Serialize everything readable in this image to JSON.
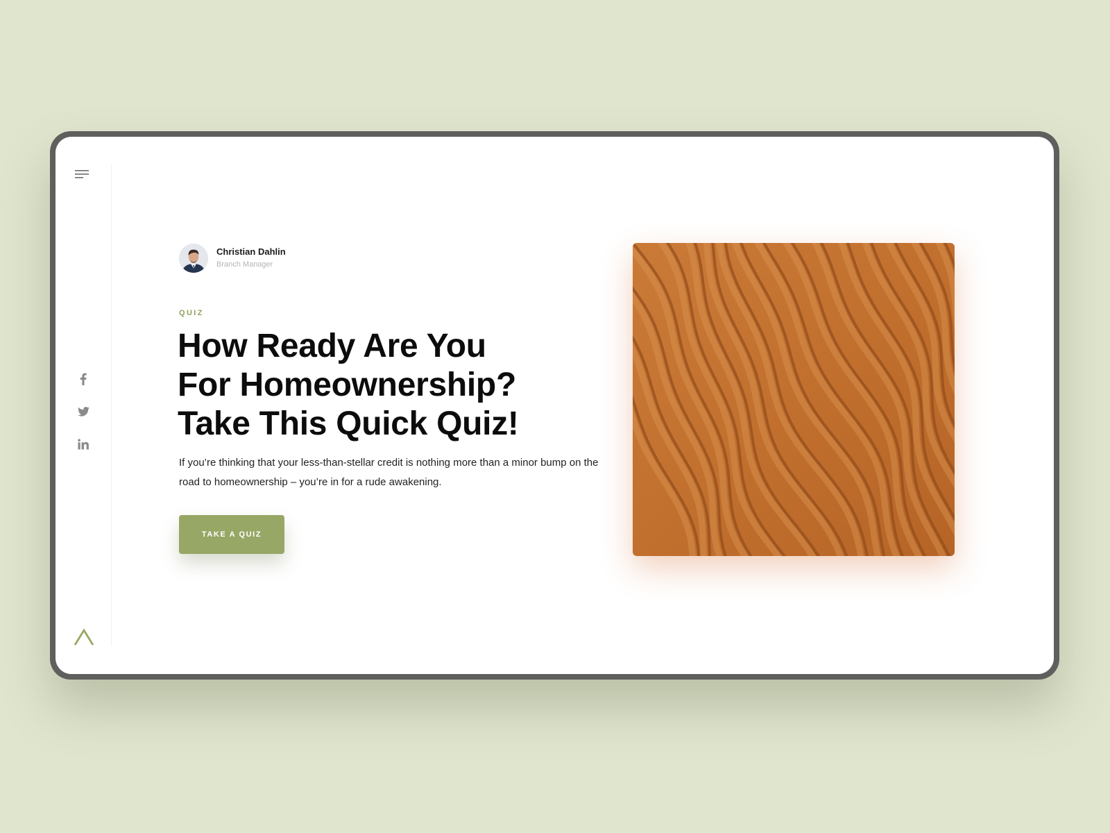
{
  "sidebar": {
    "menu_icon": "menu-icon",
    "social_icons": [
      "facebook-icon",
      "twitter-icon",
      "linkedin-icon"
    ],
    "logo_icon": "caret-up-logo-icon",
    "accent_color": "#97a766"
  },
  "author": {
    "name": "Christian Dahlin",
    "role": "Branch Manager"
  },
  "article": {
    "tag": "QUIZ",
    "headline_lines": [
      "How Ready Are You",
      "For Homeownership?",
      "Take This Quick Quiz!"
    ],
    "description": "If you’re thinking that your less-than-stellar credit is nothing more than a minor bump on the road to homeownership – you’re in for a rude awakening.",
    "cta_label": "TAKE A QUIZ",
    "cta_color": "#97a766"
  },
  "hero": {
    "image": "desert-sand-dunes-image",
    "sand_color": "#c26a27"
  },
  "colors": {
    "page_background": "#e0e5ce",
    "frame": "#5f5f5d",
    "tag_text": "#8fa25c"
  }
}
